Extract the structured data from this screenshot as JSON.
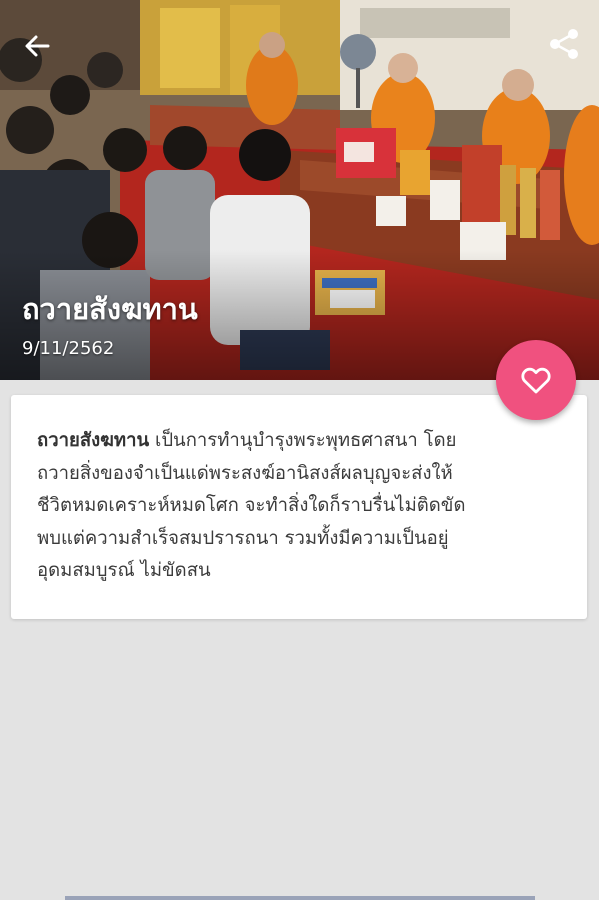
{
  "header": {
    "back_icon": "arrow-left-icon",
    "share_icon": "share-icon",
    "title": "ถวายสังฆทาน",
    "date": "9/11/2562",
    "favorite_icon": "heart-outline-icon"
  },
  "colors": {
    "favorite_button": "#f0517f",
    "background": "#e3e3e3",
    "card": "#ffffff"
  },
  "content": {
    "bold_term": "ถวายสังฆทาน",
    "line1_rest": " เป็นการทำนุบำรุงพระพุทธศาสนา โดย",
    "line2": "ถวายสิ่งของจำเป็นแด่พระสงฆ์อานิสงส์ผลบุญจะส่งให้",
    "line3": "ชีวิตหมดเคราะห์หมดโศก จะทำสิ่งใดก็ราบรื่นไม่ติดขัด",
    "line4": "พบแต่ความสำเร็จสมปรารถนา รวมทั้งมีความเป็นอยู่",
    "line5": "อุดมสมบูรณ์ ไม่ขัดสน"
  }
}
